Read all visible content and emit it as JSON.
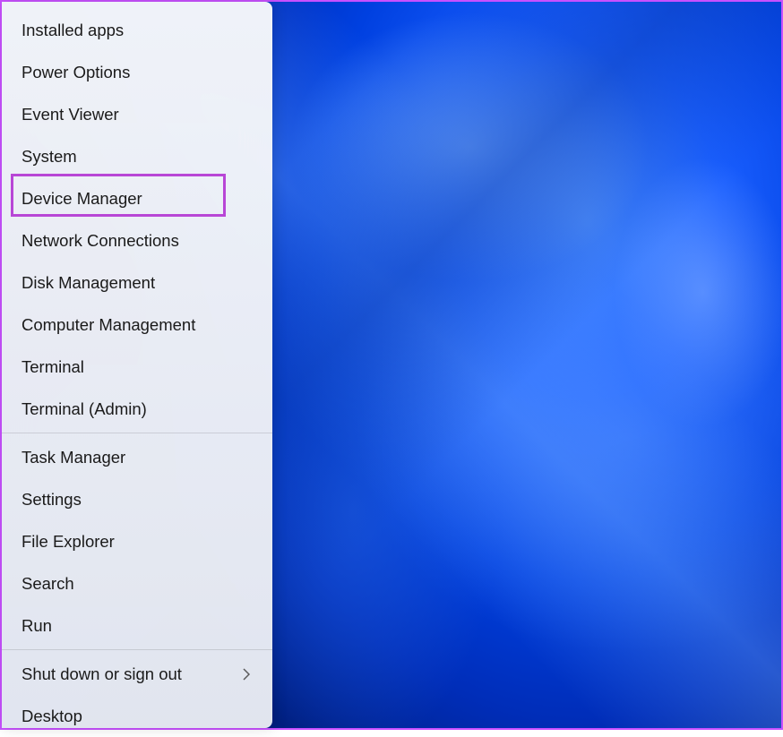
{
  "menu": {
    "groups": [
      {
        "items": [
          {
            "id": "installed-apps",
            "label": "Installed apps",
            "submenu": false
          },
          {
            "id": "power-options",
            "label": "Power Options",
            "submenu": false
          },
          {
            "id": "event-viewer",
            "label": "Event Viewer",
            "submenu": false
          },
          {
            "id": "system",
            "label": "System",
            "submenu": false
          },
          {
            "id": "device-manager",
            "label": "Device Manager",
            "submenu": false,
            "highlighted": true
          },
          {
            "id": "network-connections",
            "label": "Network Connections",
            "submenu": false
          },
          {
            "id": "disk-management",
            "label": "Disk Management",
            "submenu": false
          },
          {
            "id": "computer-management",
            "label": "Computer Management",
            "submenu": false
          },
          {
            "id": "terminal",
            "label": "Terminal",
            "submenu": false
          },
          {
            "id": "terminal-admin",
            "label": "Terminal (Admin)",
            "submenu": false
          }
        ]
      },
      {
        "items": [
          {
            "id": "task-manager",
            "label": "Task Manager",
            "submenu": false
          },
          {
            "id": "settings",
            "label": "Settings",
            "submenu": false
          },
          {
            "id": "file-explorer",
            "label": "File Explorer",
            "submenu": false
          },
          {
            "id": "search",
            "label": "Search",
            "submenu": false
          },
          {
            "id": "run",
            "label": "Run",
            "submenu": false
          }
        ]
      },
      {
        "items": [
          {
            "id": "shut-down",
            "label": "Shut down or sign out",
            "submenu": true
          },
          {
            "id": "desktop",
            "label": "Desktop",
            "submenu": false
          }
        ]
      }
    ]
  },
  "highlight_color": "#b846d6"
}
